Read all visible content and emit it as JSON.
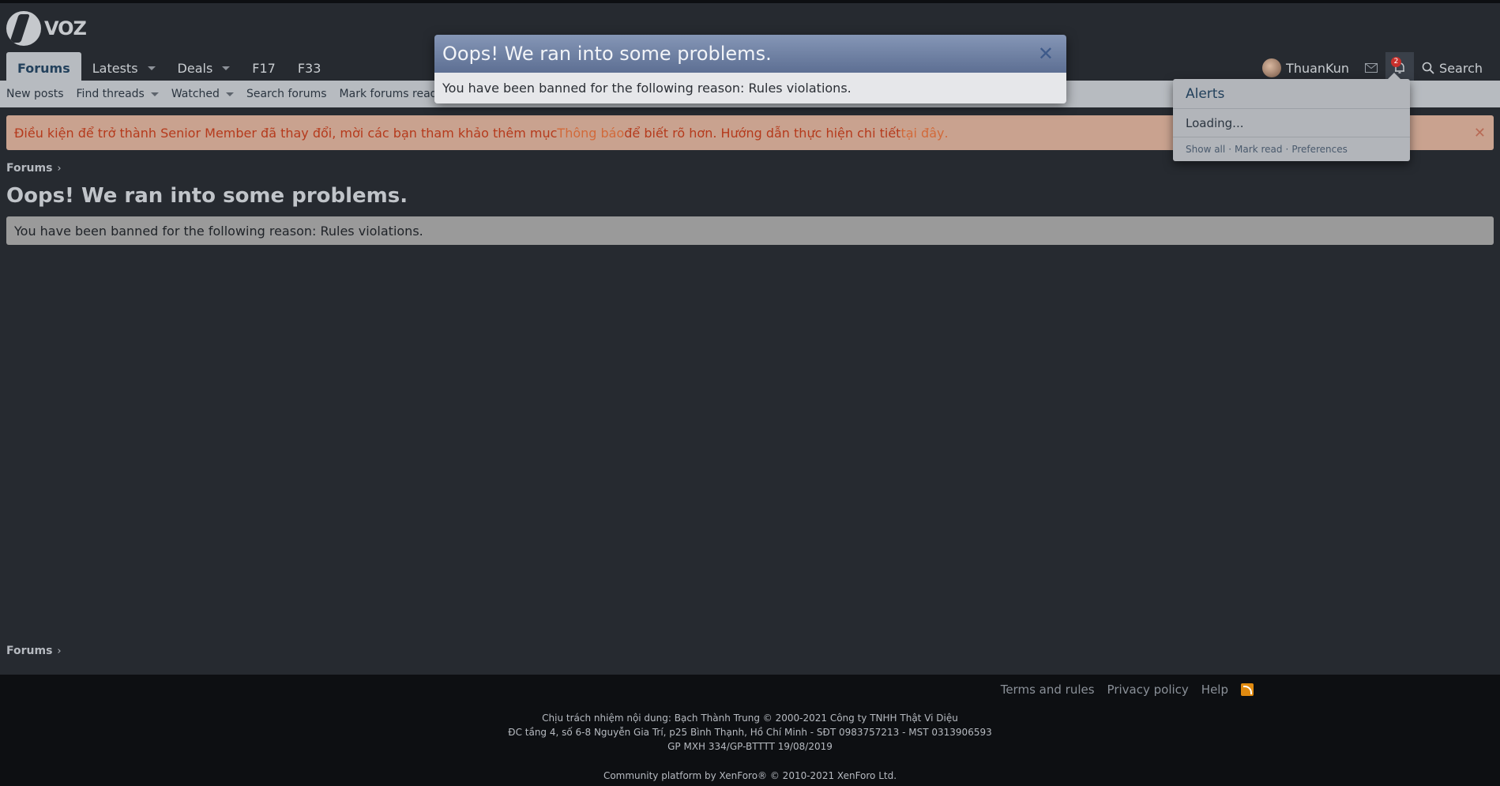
{
  "site": {
    "logo_text": "VOZ"
  },
  "nav": {
    "tabs": [
      {
        "label": "Forums"
      },
      {
        "label": "Latests"
      },
      {
        "label": "Deals"
      },
      {
        "label": "F17"
      },
      {
        "label": "F33"
      }
    ]
  },
  "user": {
    "name": "ThuanKun",
    "alert_count": "2",
    "search_label": "Search"
  },
  "subnav": {
    "items": [
      "New posts",
      "Find threads",
      "Watched",
      "Search forums",
      "Mark forums read"
    ]
  },
  "notice": {
    "part1": "Điều kiện để trở thành Senior Member đã thay đổi, mời các bạn tham khảo thêm mục ",
    "link1": "Thông báo",
    "part2": " để biết rõ hơn. Hướng dẫn thực hiện chi tiết ",
    "link2": "tại đây",
    "part3": ".",
    "close": "✕"
  },
  "breadcrumb": {
    "label": "Forums",
    "chev": "›"
  },
  "page": {
    "title": "Oops! We ran into some problems.",
    "message": "You have been banned for the following reason: Rules violations."
  },
  "dialog": {
    "title": "Oops! We ran into some problems.",
    "message": "You have been banned for the following reason: Rules violations.",
    "close": "✕"
  },
  "alerts": {
    "title": "Alerts",
    "loading": "Loading...",
    "show_all": "Show all",
    "mark_read": "Mark read",
    "preferences": "Preferences",
    "sep": "·"
  },
  "footer": {
    "links": [
      "Terms and rules",
      "Privacy policy",
      "Help"
    ],
    "line1": "Chịu trách nhiệm nội dung: Bạch Thành Trung © 2000-2021 Công ty TNHH Thật Vi Diệu",
    "line2": "ĐC tầng 4, số 6-8 Nguyễn Gia Trí, p25 Bình Thạnh, Hồ Chí Minh - SĐT 0983757213 - MST 0313906593",
    "line3": "GP MXH 334/GP-BTTTT 19/08/2019",
    "line4": "Community platform by XenForo® © 2010-2021 XenForo Ltd."
  },
  "icons": {
    "mail": "envelope-icon",
    "bell": "bell-icon",
    "search": "search-icon",
    "rss": "rss-icon"
  }
}
